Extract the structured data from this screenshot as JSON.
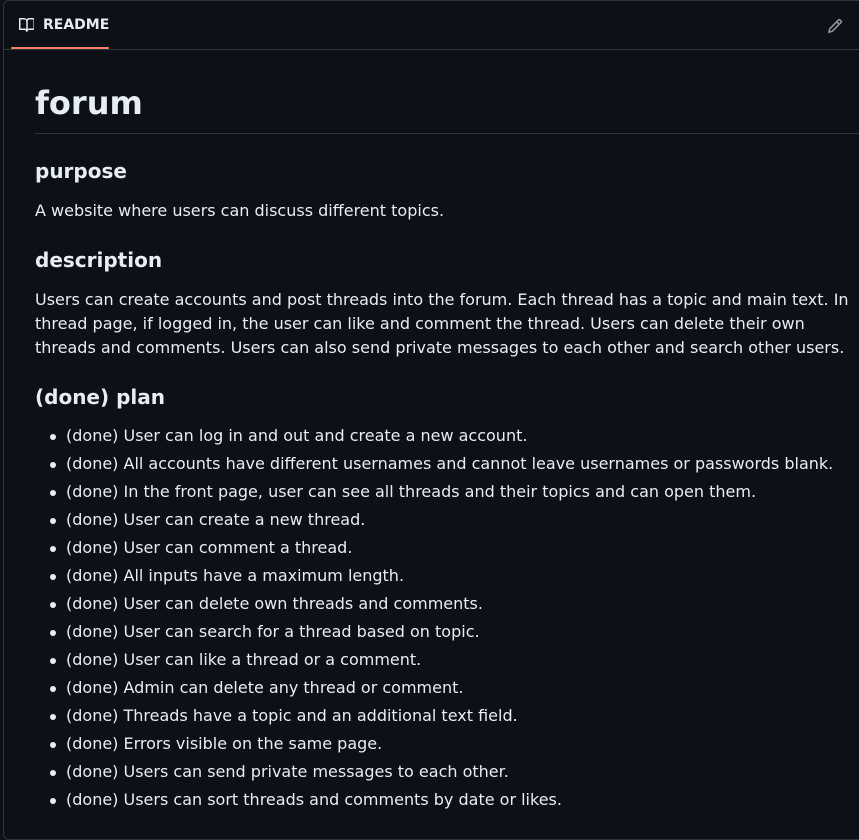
{
  "tab": {
    "label": "README",
    "icon": "book-icon"
  },
  "edit": {
    "icon": "pencil-icon"
  },
  "readme": {
    "title": "forum",
    "sections": {
      "purpose": {
        "heading": "purpose",
        "text": "A website where users can discuss different topics."
      },
      "description": {
        "heading": "description",
        "text": "Users can create accounts and post threads into the forum. Each thread has a topic and main text. In thread page, if logged in, the user can like and comment the thread. Users can delete their own threads and comments. Users can also send private messages to each other and search other users."
      },
      "plan": {
        "heading": "(done) plan",
        "items": [
          "(done) User can log in and out and create a new account.",
          "(done) All accounts have different usernames and cannot leave usernames or passwords blank.",
          "(done) In the front page, user can see all threads and their topics and can open them.",
          "(done) User can create a new thread.",
          "(done) User can comment a thread.",
          "(done) All inputs have a maximum length.",
          "(done) User can delete own threads and comments.",
          "(done) User can search for a thread based on topic.",
          "(done) User can like a thread or a comment.",
          "(done) Admin can delete any thread or comment.",
          "(done) Threads have a topic and an additional text field.",
          "(done) Errors visible on the same page.",
          "(done) Users can send private messages to each other.",
          "(done) Users can sort threads and comments by date or likes."
        ]
      }
    }
  },
  "colors": {
    "background": "#0d1117",
    "border": "#30363d",
    "text": "#e6edf3",
    "tab_accent": "#f78166"
  }
}
